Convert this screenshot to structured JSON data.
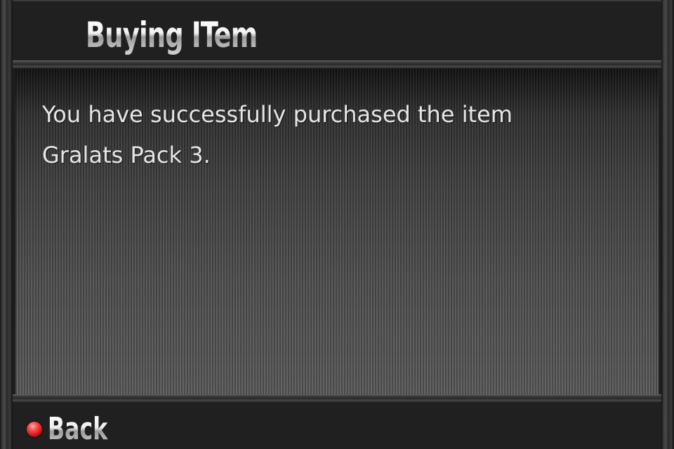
{
  "dialog": {
    "title": "Buying ITem",
    "message_line1": "You have successfully purchased the item",
    "message_line2": "Gralats Pack 3."
  },
  "footer": {
    "back_label": "Back",
    "back_icon": "red-dot-icon"
  },
  "colors": {
    "accent_red": "#e02020",
    "text": "#e6e6e6"
  }
}
